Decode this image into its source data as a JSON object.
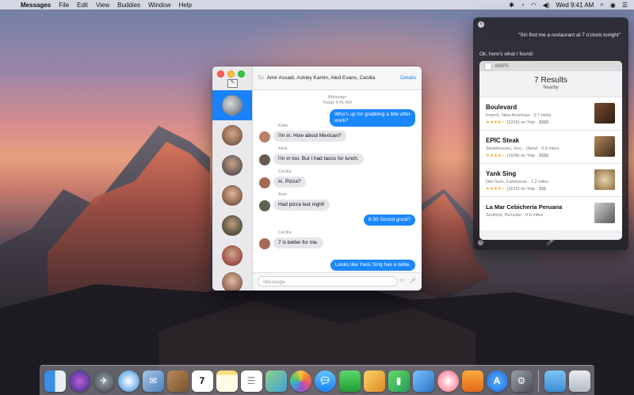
{
  "menubar": {
    "app_name": "Messages",
    "items": [
      "File",
      "Edit",
      "View",
      "Buddies",
      "Window",
      "Help"
    ],
    "clock": "Wed 9:41 AM"
  },
  "messages_window": {
    "to_label": "To:",
    "recipients": "Amir Assadi, Ashley Kamin, Aled Evans, Cecilia",
    "details_label": "Details",
    "service": "iMessage",
    "timestamp": "Today 9:41 AM",
    "input_placeholder": "iMessage",
    "transcript": [
      {
        "from": "me",
        "text": "Who's up for grabbing a bite after work?"
      },
      {
        "from": "Katie",
        "text": "I'm in. How about Mexican?"
      },
      {
        "from": "Aled",
        "text": "I'm in too. But I had tacos for lunch."
      },
      {
        "from": "Cecilia",
        "text": "In. Pizza?"
      },
      {
        "from": "Amir",
        "text": "Had pizza last night!"
      },
      {
        "from": "me",
        "text": "6:30 Sound good?"
      },
      {
        "from": "Cecilia",
        "text": "7 is better for me."
      },
      {
        "from": "me",
        "text": "Looks like Yank Sing has a table."
      }
    ]
  },
  "siri": {
    "query": "\"Siri find me a restaurant at 7 o'clock tonight\"",
    "answer": "Ok, here's what I found:",
    "card_title": "MAPS",
    "results_count": "7 Results",
    "results_sub": "Nearby",
    "results": [
      {
        "name": "Boulevard",
        "detail": "French, New American · 0.7 miles",
        "stars": "★★★★☆",
        "rating": "(2229) on Yelp · $$$$"
      },
      {
        "name": "EPIC Steak",
        "detail": "Steakhouses, Sea... (New) · 0.8 miles",
        "stars": "★★★★☆",
        "rating": "(1608) on Yelp · $$$$"
      },
      {
        "name": "Yank Sing",
        "detail": "Dim Sum, Cantonese · 1.2 miles",
        "stars": "★★★★☆",
        "rating": "(2010) on Yelp · $$$"
      },
      {
        "name": "La Mar Cebichería Peruana",
        "detail": "Seafood, Peruvian · 0.8 miles",
        "stars": "★★★★☆",
        "rating": ""
      }
    ]
  },
  "colors": {
    "imessage_blue": "#1a87fa",
    "incoming_gray": "#e5e5ea",
    "siri_bg": "#1c1c22"
  }
}
